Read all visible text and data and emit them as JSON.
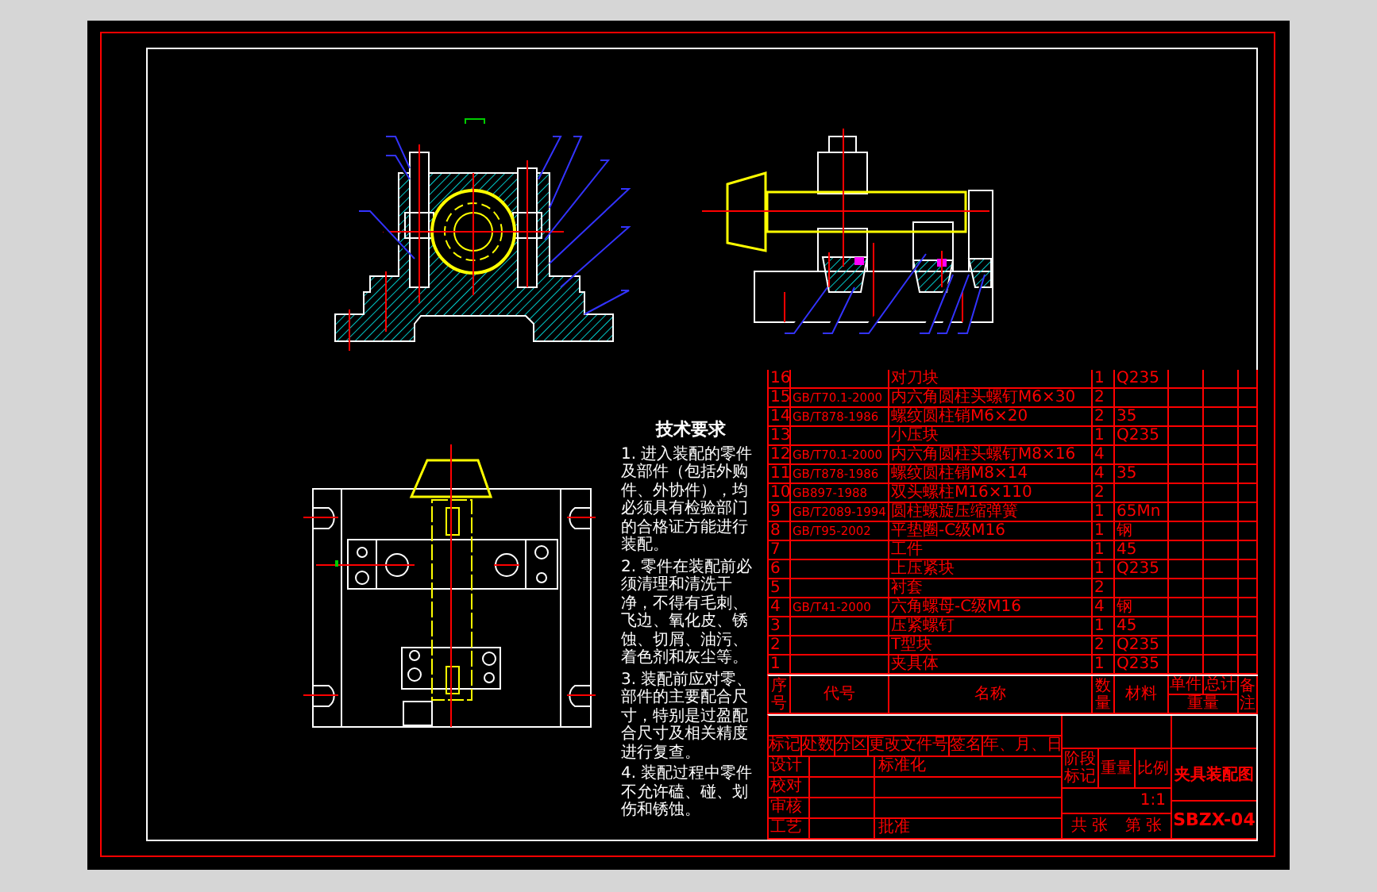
{
  "technical_requirements": {
    "title": "技术要求",
    "items": [
      "1. 进入装配的零件及部件（包括外购件、外协件），均必须具有检验部门的合格证方能进行装配。",
      "2. 零件在装配前必须清理和清洗干净，不得有毛刺、飞边、氧化皮、锈蚀、切屑、油污、着色剂和灰尘等。",
      "3. 装配前应对零、部件的主要配合尺寸，特别是过盈配合尺寸及相关精度进行复查。",
      "4. 装配过程中零件不允许磕、碰、划伤和锈蚀。"
    ]
  },
  "parts_list": {
    "rows": [
      {
        "no": "16",
        "code": "",
        "name": "对刀块",
        "qty": "1",
        "material": "Q235"
      },
      {
        "no": "15",
        "code": "GB/T70.1-2000",
        "name": "内六角圆柱头螺钉M6×30",
        "qty": "2",
        "material": ""
      },
      {
        "no": "14",
        "code": "GB/T878-1986",
        "name": "螺纹圆柱销M6×20",
        "qty": "2",
        "material": "35"
      },
      {
        "no": "13",
        "code": "",
        "name": "小压块",
        "qty": "1",
        "material": "Q235"
      },
      {
        "no": "12",
        "code": "GB/T70.1-2000",
        "name": "内六角圆柱头螺钉M8×16",
        "qty": "4",
        "material": ""
      },
      {
        "no": "11",
        "code": "GB/T878-1986",
        "name": "螺纹圆柱销M8×14",
        "qty": "4",
        "material": "35"
      },
      {
        "no": "10",
        "code": "GB897-1988",
        "name": "双头螺柱M16×110",
        "qty": "2",
        "material": ""
      },
      {
        "no": "9",
        "code": "GB/T2089-1994",
        "name": "圆柱螺旋压缩弹簧",
        "qty": "1",
        "material": "65Mn"
      },
      {
        "no": "8",
        "code": "GB/T95-2002",
        "name": "平垫圈-C级M16",
        "qty": "1",
        "material": "钢"
      },
      {
        "no": "7",
        "code": "",
        "name": "工件",
        "qty": "1",
        "material": "45"
      },
      {
        "no": "6",
        "code": "",
        "name": "上压紧块",
        "qty": "1",
        "material": "Q235"
      },
      {
        "no": "5",
        "code": "",
        "name": "衬套",
        "qty": "2",
        "material": ""
      },
      {
        "no": "4",
        "code": "GB/T41-2000",
        "name": "六角螺母-C级M16",
        "qty": "4",
        "material": "钢"
      },
      {
        "no": "3",
        "code": "",
        "name": "压紧螺钉",
        "qty": "1",
        "material": "45"
      },
      {
        "no": "2",
        "code": "",
        "name": "T型块",
        "qty": "2",
        "material": "Q235"
      },
      {
        "no": "1",
        "code": "",
        "name": "夹具体",
        "qty": "1",
        "material": "Q235"
      }
    ],
    "header": {
      "no": "序号",
      "code": "代号",
      "name": "名称",
      "qty": "数量",
      "material": "材料",
      "unit": "单件",
      "total": "总计",
      "weight": "重量",
      "notes": "备注"
    }
  },
  "title_block": {
    "revision_header": [
      "标记",
      "处数",
      "分区",
      "更改文件号",
      "签名",
      "年、月、日"
    ],
    "signoffs": [
      {
        "label": "设计",
        "label_2": "标准化"
      },
      {
        "label": "校对"
      },
      {
        "label": "审核"
      },
      {
        "label": "工艺",
        "label_2": "批准"
      }
    ],
    "stage_header": [
      "阶段标记",
      "重量",
      "比例"
    ],
    "scale": "1:1",
    "sheet_total": "共 张",
    "sheet_number": "第 张",
    "drawing_title": "夹具装配图",
    "drawing_number": "SBZX-04"
  }
}
